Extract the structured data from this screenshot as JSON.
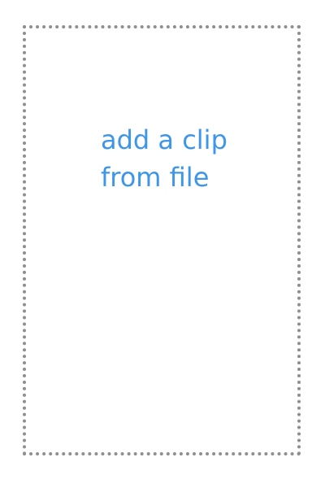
{
  "dropzone": {
    "label_line_1": "add a clip",
    "label_line_2": "from file"
  },
  "colors": {
    "accent": "#3d96e8",
    "border": "#8f8f8f",
    "background": "#ffffff"
  }
}
